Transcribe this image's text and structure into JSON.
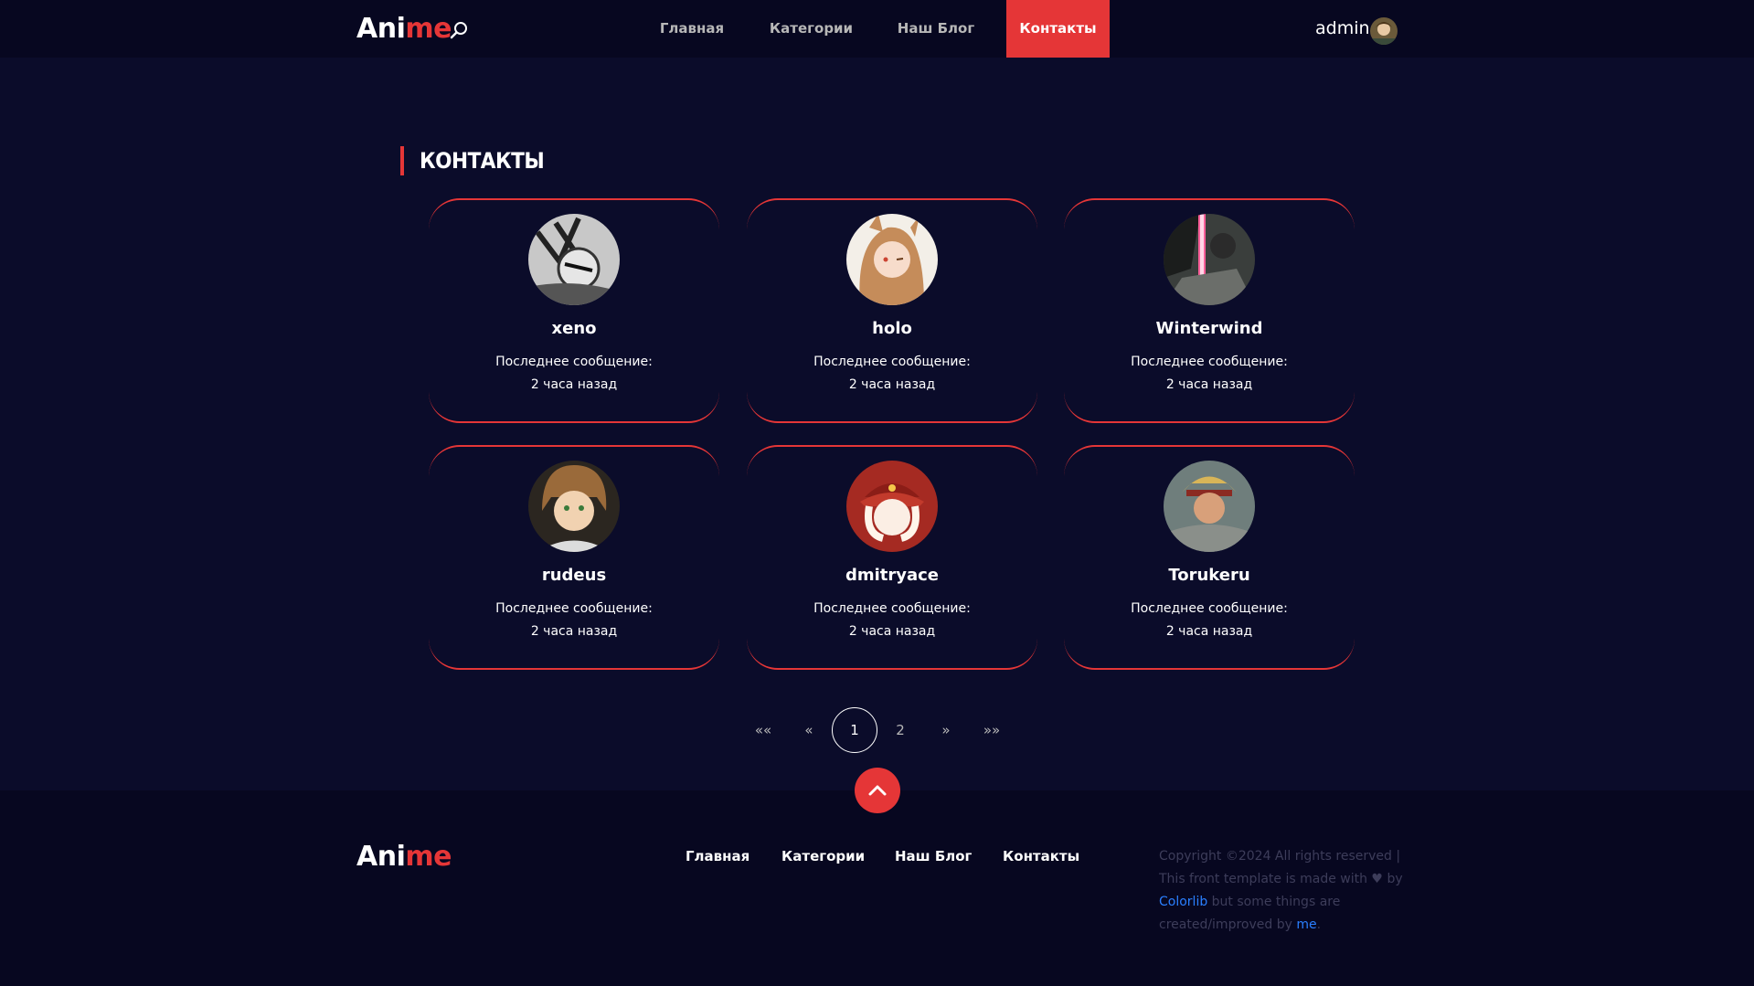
{
  "header": {
    "logo_a": "Ani",
    "logo_b": "me",
    "nav": [
      {
        "label": "Главная"
      },
      {
        "label": "Категории"
      },
      {
        "label": "Наш Блог"
      },
      {
        "label": "Контакты"
      }
    ],
    "user_name": "admin"
  },
  "section_title": "КОНТАКТЫ",
  "contacts": [
    {
      "name": "xeno",
      "msg_label": "Последнее сообщение:",
      "msg_time": "2 часа назад"
    },
    {
      "name": "holo",
      "msg_label": "Последнее сообщение:",
      "msg_time": "2 часа назад"
    },
    {
      "name": "Winterwind",
      "msg_label": "Последнее сообщение:",
      "msg_time": "2 часа назад"
    },
    {
      "name": "rudeus",
      "msg_label": "Последнее сообщение:",
      "msg_time": "2 часа назад"
    },
    {
      "name": "dmitryace",
      "msg_label": "Последнее сообщение:",
      "msg_time": "2 часа назад"
    },
    {
      "name": "Torukeru",
      "msg_label": "Последнее сообщение:",
      "msg_time": "2 часа назад"
    }
  ],
  "pagination": {
    "first": "««",
    "prev": "«",
    "pages": [
      "1",
      "2"
    ],
    "current": "1",
    "next": "»",
    "last": "»»"
  },
  "footer": {
    "logo_a": "Ani",
    "logo_b": "me",
    "links": [
      "Главная",
      "Категории",
      "Наш Блог",
      "Контакты"
    ],
    "copyright_1": "Copyright ©2024 All rights reserved | This front template is made with",
    "copyright_2": "by",
    "colorlib": "Colorlib",
    "copyright_3": "but some things are created/improved by",
    "me": "me",
    "copyright_end": "."
  },
  "colors": {
    "accent": "#e53637",
    "background": "#0b0c2a",
    "header": "#070720",
    "link": "#2a7fff"
  }
}
